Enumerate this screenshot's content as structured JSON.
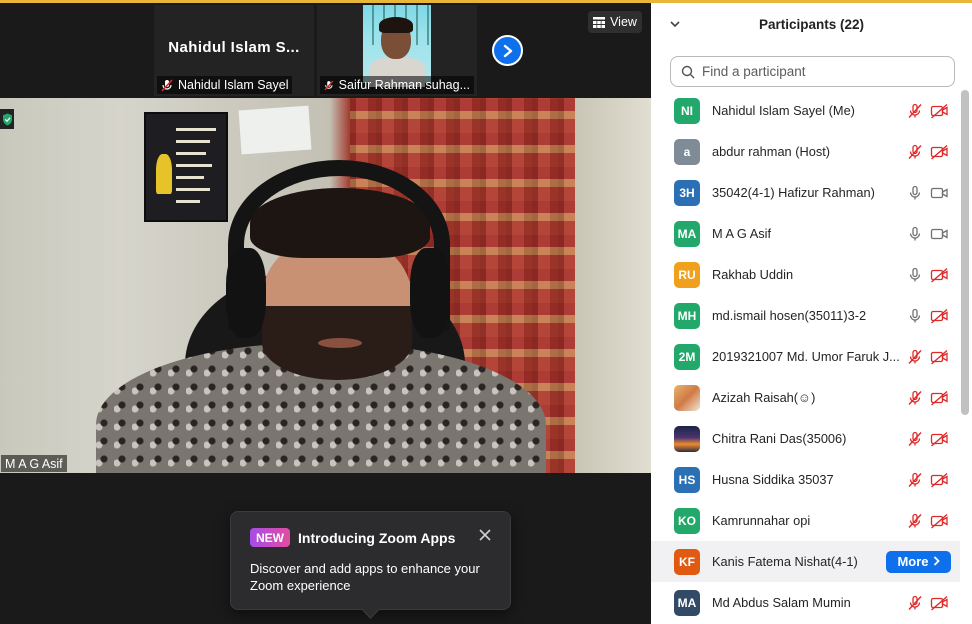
{
  "meeting": {
    "view_label": "View",
    "speaker_name": "M A G Asif",
    "tiles": [
      {
        "big_name": "Nahidul  Islam  S...",
        "label": "Nahidul Islam Sayel"
      },
      {
        "label": "Saifur Rahman suhag..."
      }
    ]
  },
  "toast": {
    "badge": "NEW",
    "title": "Introducing Zoom Apps",
    "body": "Discover and add apps to enhance your Zoom experience"
  },
  "panel": {
    "title": "Participants (22)",
    "search_placeholder": "Find a participant",
    "more_label": "More",
    "participants": [
      {
        "initials": "NI",
        "name": "Nahidul Islam Sayel (Me)",
        "color": "#23a86b",
        "mic": "muted",
        "cam": "off"
      },
      {
        "initials": "a",
        "name": "abdur rahman (Host)",
        "color": "#7f8c97",
        "mic": "muted",
        "cam": "off"
      },
      {
        "initials": "3H",
        "name": "35042(4-1) Hafizur Rahman)",
        "color": "#2b6fb4",
        "mic": "on",
        "cam": "on"
      },
      {
        "initials": "MA",
        "name": "M A G Asif",
        "color": "#23a86b",
        "mic": "on",
        "cam": "on"
      },
      {
        "initials": "RU",
        "name": "Rakhab Uddin",
        "color": "#f0a01c",
        "mic": "on",
        "cam": "off"
      },
      {
        "initials": "MH",
        "name": "md.ismail hosen(35011)3-2",
        "color": "#23a86b",
        "mic": "on",
        "cam": "off"
      },
      {
        "initials": "2M",
        "name": "2019321007 Md. Umor Faruk J...",
        "color": "#23a86b",
        "mic": "muted",
        "cam": "off"
      },
      {
        "initials": "",
        "name": "Azizah Raisah(☺)",
        "color": "",
        "mic": "muted",
        "cam": "off"
      },
      {
        "initials": "",
        "name": "Chitra Rani Das(35006)",
        "color": "",
        "mic": "muted",
        "cam": "off"
      },
      {
        "initials": "HS",
        "name": "Husna Siddika 35037",
        "color": "#2b6fb4",
        "mic": "muted",
        "cam": "off"
      },
      {
        "initials": "KO",
        "name": "Kamrunnahar opi",
        "color": "#23a86b",
        "mic": "muted",
        "cam": "off"
      },
      {
        "initials": "KF",
        "name": "Kanis Fatema Nishat(4-1)",
        "color": "#e05a12",
        "mic": "none",
        "cam": "none"
      },
      {
        "initials": "MA",
        "name": "Md Abdus Salam Mumin",
        "color": "#324a66",
        "mic": "muted",
        "cam": "off"
      }
    ]
  },
  "colors": {
    "accent": "#0e71eb",
    "muted_red": "#e02828",
    "top_bar": "#e8b73a"
  },
  "icons": [
    "view-grid-icon",
    "mic-muted-icon",
    "mic-icon",
    "video-icon",
    "video-off-icon",
    "search-icon",
    "chevron-down-icon",
    "chevron-right-icon",
    "close-icon",
    "shield-icon"
  ]
}
